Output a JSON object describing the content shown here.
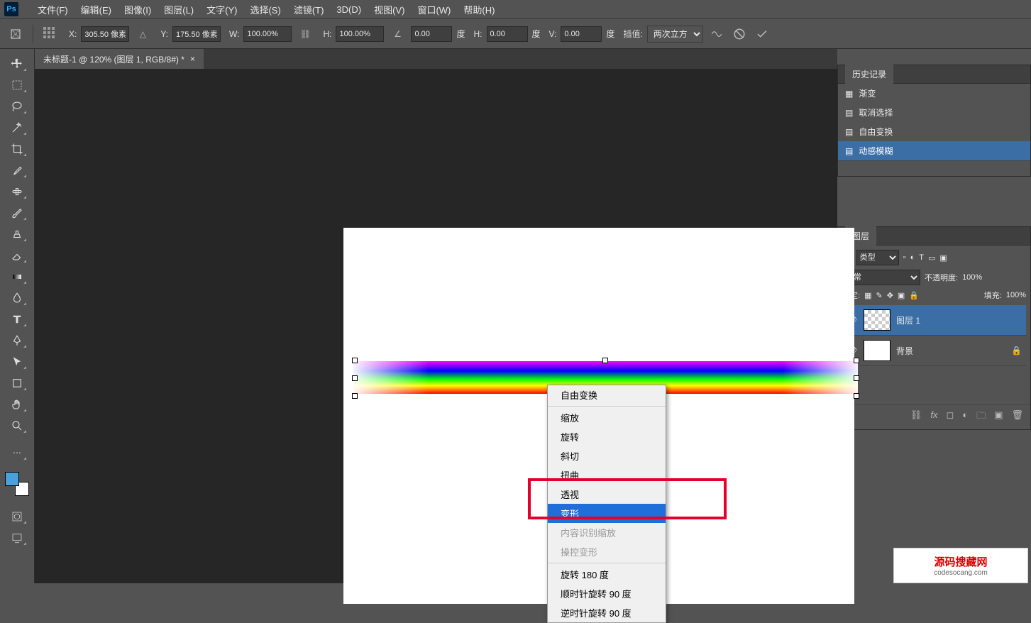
{
  "menu": [
    "文件(F)",
    "编辑(E)",
    "图像(I)",
    "图层(L)",
    "文字(Y)",
    "选择(S)",
    "滤镜(T)",
    "3D(D)",
    "视图(V)",
    "窗口(W)",
    "帮助(H)"
  ],
  "opt": {
    "x_label": "X:",
    "x": "305.50 像素",
    "y_label": "Y:",
    "y": "175.50 像素",
    "w_label": "W:",
    "w": "100.00%",
    "h_label": "H:",
    "h": "100.00%",
    "a_label": "",
    "a": "0.00",
    "a_unit": "度",
    "h2_label": "H:",
    "h2": "0.00",
    "h2_unit": "度",
    "v_label": "V:",
    "v": "0.00",
    "v_unit": "度",
    "interp_label": "插值:",
    "interp": "两次立方"
  },
  "tab": {
    "title": "未标题-1 @ 120% (图层 1, RGB/8#) *"
  },
  "ctx": {
    "free": "自由变换",
    "scale": "缩放",
    "rotate": "旋转",
    "skew": "斜切",
    "distort": "扭曲",
    "perspective": "透视",
    "warp": "变形",
    "content_aware": "内容识别缩放",
    "puppet": "操控变形",
    "r180": "旋转 180 度",
    "r90cw": "顺时针旋转 90 度",
    "r90ccw": "逆时针旋转 90 度"
  },
  "history": {
    "title": "历史记录",
    "items": [
      "渐变",
      "取消选择",
      "自由变换",
      "动感模糊"
    ]
  },
  "layers": {
    "title": "图层",
    "kind_label": "类型",
    "blend": "正常",
    "opacity_label": "不透明度:",
    "opacity": "100%",
    "lock_label": "锁定:",
    "fill_label": "填充:",
    "fill": "100%",
    "layer1": "图层 1",
    "bg": "背景"
  },
  "watermark": {
    "text": "源码搜藏网",
    "url": "codesocang.com"
  }
}
